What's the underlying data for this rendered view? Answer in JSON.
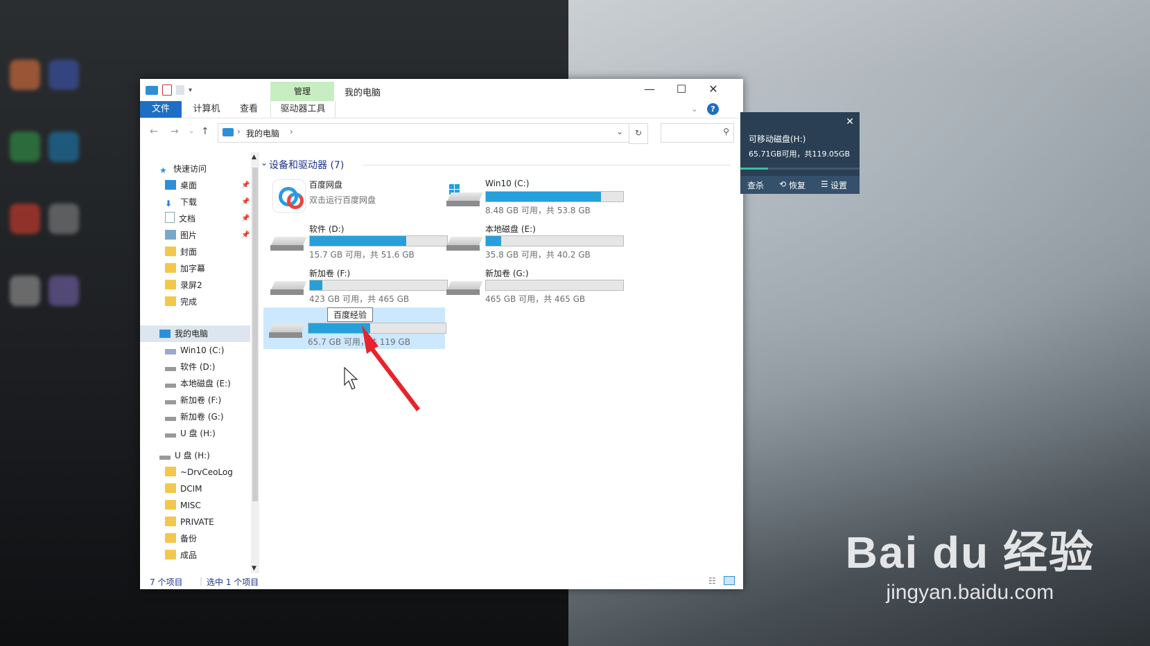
{
  "window": {
    "title": "我的电脑",
    "context_tab": "管理",
    "controls": {
      "minimize": "—",
      "maximize": "☐",
      "close": "✕"
    }
  },
  "ribbon": {
    "tabs": [
      "文件",
      "计算机",
      "查看",
      "驱动器工具"
    ],
    "help": "?"
  },
  "address": {
    "crumb": "我的电脑",
    "separator": "›",
    "dropdown": "⌄",
    "refresh": "↻",
    "search_icon": "⚲",
    "back": "←",
    "forward": "→",
    "recent": "⌄",
    "up": "↑"
  },
  "nav": {
    "quick_access": "快速访问",
    "quick_items": [
      "桌面",
      "下载",
      "文档",
      "图片",
      "封面",
      "加字幕",
      "录屏2",
      "完成"
    ],
    "this_pc": "我的电脑",
    "pc_items": [
      "Win10 (C:)",
      "软件 (D:)",
      "本地磁盘 (E:)",
      "新加卷 (F:)",
      "新加卷 (G:)",
      "U 盘 (H:)"
    ],
    "usb_root": "U 盘 (H:)",
    "usb_items": [
      "~DrvCeoLog",
      "DCIM",
      "MISC",
      "PRIVATE",
      "备份",
      "成品"
    ],
    "pin_glyph": "📌"
  },
  "content": {
    "group_title": "设备和驱动器 (7)",
    "group_chevron": "⌄",
    "baidu": {
      "name": "百度网盘",
      "sub": "双击运行百度网盘"
    },
    "drives": [
      {
        "name": "Win10 (C:)",
        "free": "8.48 GB 可用，共 53.8 GB",
        "used_fraction": 0.84
      },
      {
        "name": "软件 (D:)",
        "free": "15.7 GB 可用，共 51.6 GB",
        "used_fraction": 0.7
      },
      {
        "name": "本地磁盘 (E:)",
        "free": "35.8 GB 可用，共 40.2 GB",
        "used_fraction": 0.11
      },
      {
        "name": "新加卷 (F:)",
        "free": "423 GB 可用，共 465 GB",
        "used_fraction": 0.09
      },
      {
        "name": "新加卷 (G:)",
        "free": "465 GB 可用，共 465 GB",
        "used_fraction": 0.0
      },
      {
        "name": "",
        "free": "65.7 GB 可用，共 119 GB",
        "used_fraction": 0.45,
        "tooltip": "百度经验"
      }
    ]
  },
  "status": {
    "count": "7 个项目",
    "selected": "选中 1 个项目"
  },
  "usb_popup": {
    "title": "可移动磁盘(H:)",
    "space": "65.71GB可用，共119.05GB",
    "close": "✕",
    "buttons": [
      "查杀",
      "恢复",
      "设置"
    ]
  },
  "watermark": {
    "brand": "Bai du 经验",
    "url": "jingyan.baidu.com"
  },
  "colors": {
    "accent": "#1e6fc3",
    "bar": "#26a0da",
    "selection": "#cce8ff",
    "context_tab": "#c7eec0"
  }
}
